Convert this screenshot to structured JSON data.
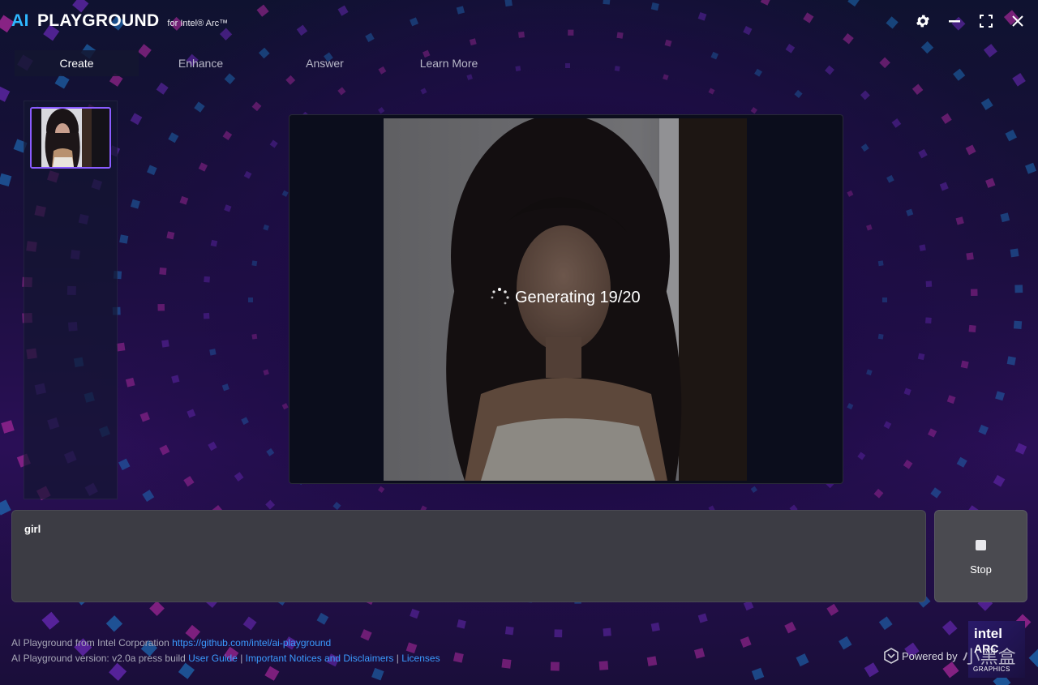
{
  "app": {
    "title_ai": "AI",
    "title_main": "PLAYGROUND",
    "title_sub": "for Intel® Arc™"
  },
  "window_controls": [
    "gear-icon",
    "minimize-icon",
    "maximize-icon",
    "close-icon"
  ],
  "tabs": [
    {
      "label": "Create",
      "active": true
    },
    {
      "label": "Enhance",
      "active": false
    },
    {
      "label": "Answer",
      "active": false
    },
    {
      "label": "Learn More",
      "active": false
    }
  ],
  "preview": {
    "status_text": "Generating 19/20",
    "progress": {
      "step": 19,
      "total": 20
    }
  },
  "prompt": {
    "value": "girl"
  },
  "stop_button": {
    "label": "Stop",
    "icon": "stop-icon"
  },
  "footer": {
    "line1_text": "AI Playground from Intel Corporation",
    "line1_link": "https://github.com/intel/ai-playground",
    "line2_text": "AI Playground version: v2.0a press build",
    "link_user_guide": "User Guide",
    "sep1": "|",
    "link_notices": "Important Notices and Disclaimers",
    "sep2": "|",
    "link_licenses": "Licenses"
  },
  "badge": {
    "line1": "intel",
    "line2": "ARC",
    "line3": "GRAPHICS"
  },
  "watermark": {
    "text": "Powered by",
    "brand": "小黑盒"
  },
  "colors": {
    "accent_blue": "#2fb8ff",
    "link_blue": "#3a9bff",
    "selection_purple": "#8a5cff",
    "prompt_bg": "#3c3c44"
  }
}
